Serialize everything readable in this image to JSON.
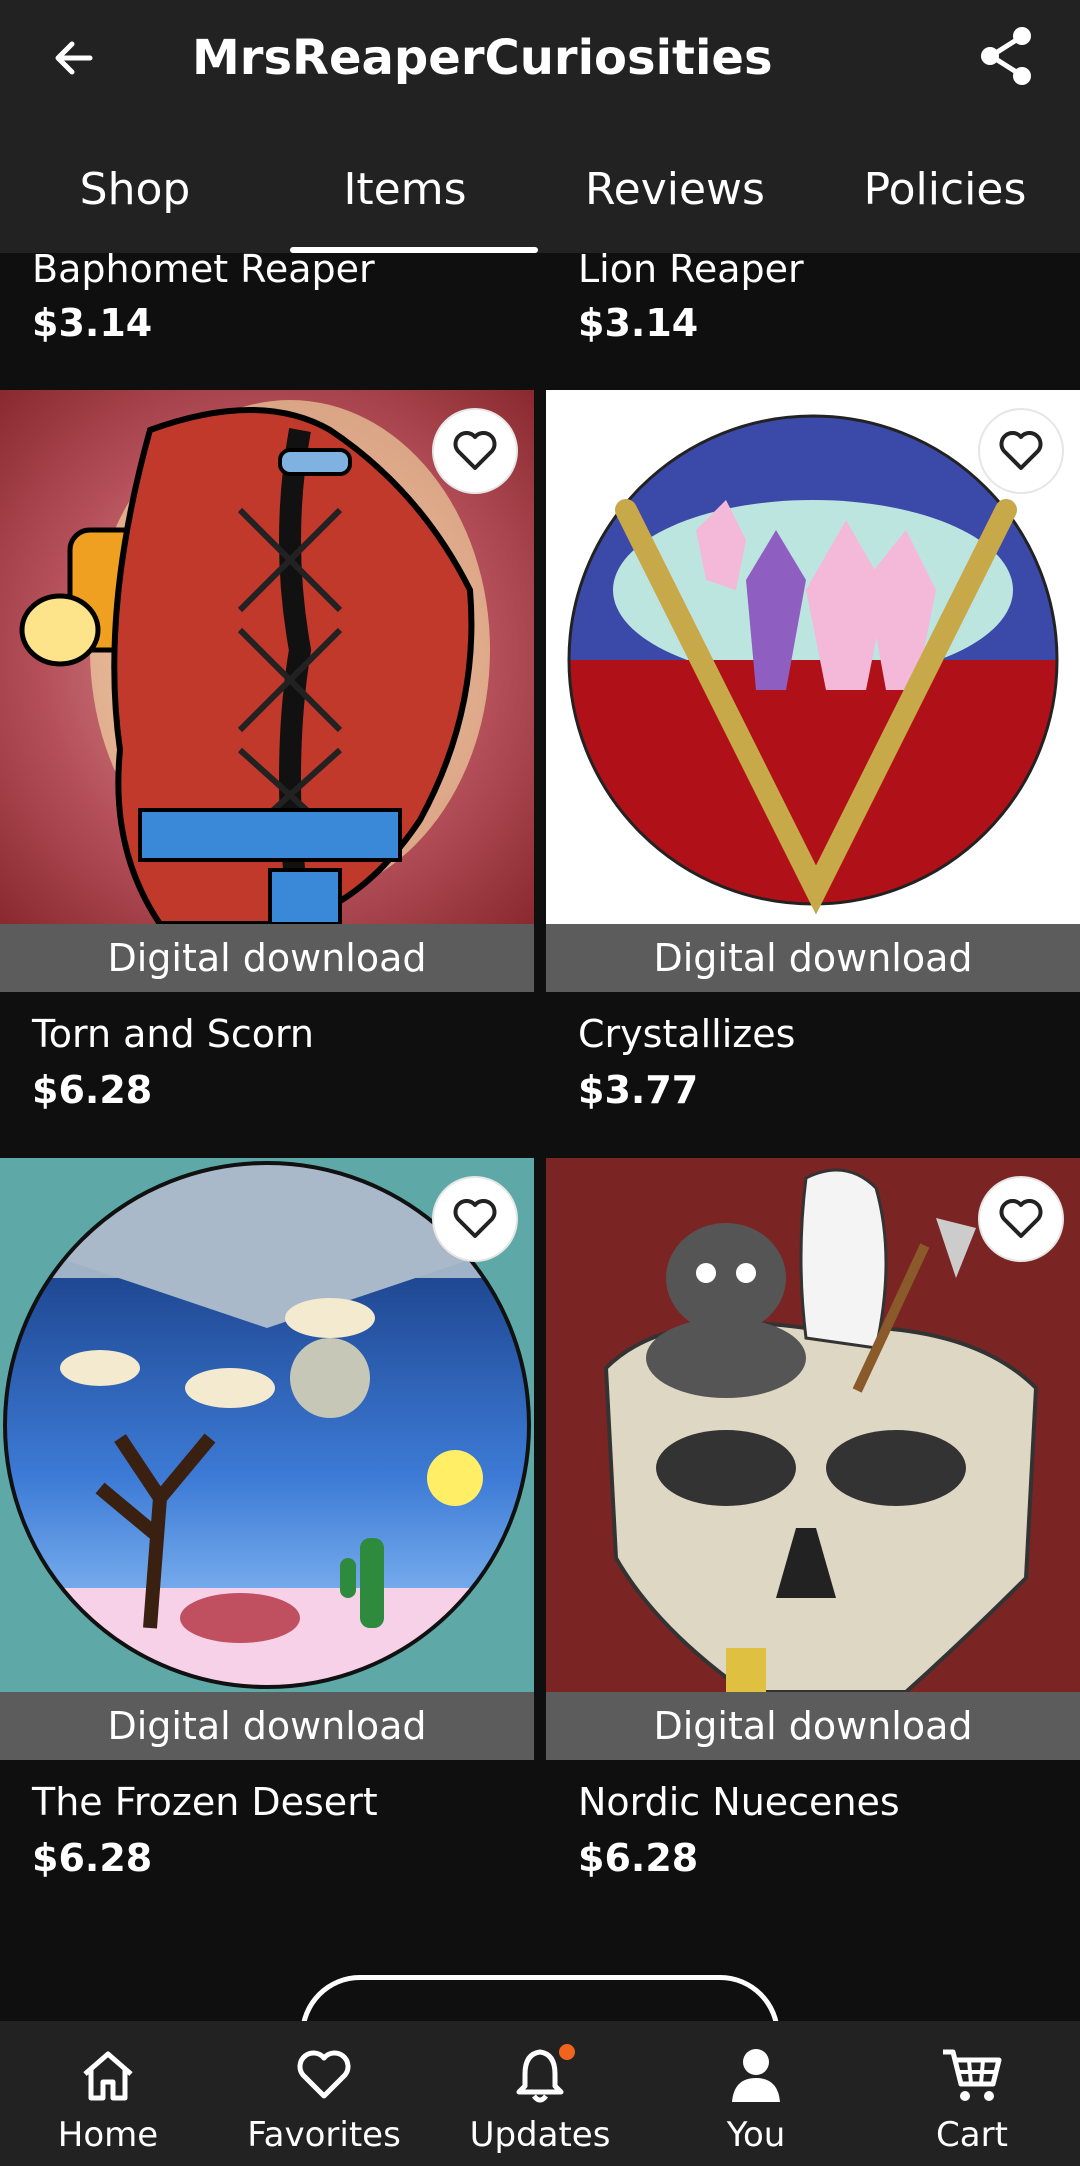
{
  "header": {
    "title": "MrsReaperCuriosities",
    "tabs": [
      {
        "label": "Shop",
        "active": false
      },
      {
        "label": "Items",
        "active": true
      },
      {
        "label": "Reviews",
        "active": false
      },
      {
        "label": "Policies",
        "active": false
      }
    ]
  },
  "listings_partial": [
    {
      "title": "Baphomet Reaper",
      "price": "$3.14"
    },
    {
      "title": "Lion Reaper",
      "price": "$3.14"
    }
  ],
  "listings": [
    {
      "title": "Torn and Scorn",
      "price": "$6.28",
      "tag": "Digital download"
    },
    {
      "title": "Crystallizes",
      "price": "$3.77",
      "tag": "Digital download"
    },
    {
      "title": "The Frozen Desert",
      "price": "$6.28",
      "tag": "Digital download"
    },
    {
      "title": "Nordic Nuecenes",
      "price": "$6.28",
      "tag": "Digital download"
    }
  ],
  "bottom_nav": [
    {
      "label": "Home",
      "icon": "home-icon"
    },
    {
      "label": "Favorites",
      "icon": "heart-icon"
    },
    {
      "label": "Updates",
      "icon": "bell-icon",
      "has_badge": true
    },
    {
      "label": "You",
      "icon": "person-icon"
    },
    {
      "label": "Cart",
      "icon": "cart-icon"
    }
  ],
  "colors": {
    "background": "#0f0f0f",
    "bar": "#222222",
    "badge": "#f1641e",
    "download_strip": "#5c5c5c"
  }
}
